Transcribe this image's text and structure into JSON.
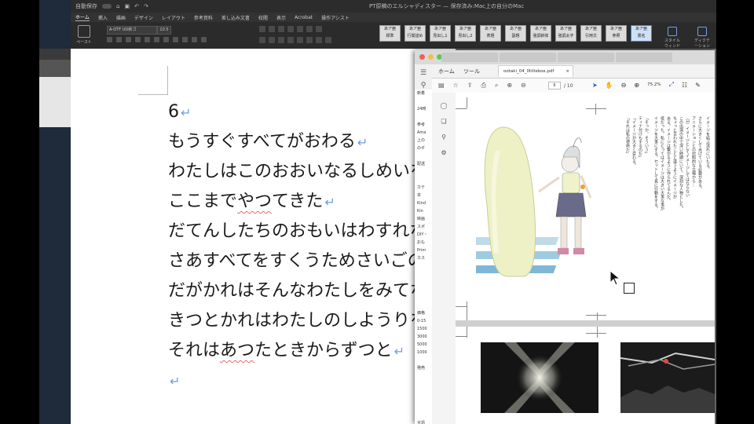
{
  "word": {
    "titlebar": {
      "autosave": "自動保存",
      "title": "PT原稿のエルシャディスター — 保存済み:Mac上の自分のMac"
    },
    "menu": [
      "ホーム",
      "挿入",
      "描画",
      "デザイン",
      "レイアウト",
      "参考資料",
      "差し込み文書",
      "校閲",
      "表示",
      "Acrobat",
      "操作アシスト"
    ],
    "ribbon": {
      "paste_label": "ペースト",
      "font_name": "A-OTF UD新ゴ",
      "font_size": "10.5",
      "styles": [
        "標準",
        "行間詰め",
        "見出し1",
        "見出し2",
        "表題",
        "副題",
        "強調斜体",
        "強調太字",
        "引用文",
        "参照",
        "書名"
      ],
      "selected_style_index": 10,
      "right_buttons": [
        "スタイル ウィンドウ",
        "ディクテーション"
      ]
    },
    "document_lines": [
      {
        "text": "6"
      },
      {
        "text": "もうすぐすべてがおわる"
      },
      {
        "text": "わたしはこのおおいなるしめいを"
      },
      {
        "text": "ここまでやつてきた",
        "wavy": "やつ"
      },
      {
        "text": "だてんしたちのおもいはわすれな"
      },
      {
        "text": "さあすべてをすくうためさいごの"
      },
      {
        "text": "だがかれはそんなわたしをみてな"
      },
      {
        "text": "きつとかれはわたしのしようりを"
      },
      {
        "text": "それはあつたときからずつと",
        "wavy": "あつ"
      },
      {
        "text": ""
      }
    ],
    "paragraph_mark": "↵"
  },
  "pdf": {
    "menu_home": "ホーム",
    "menu_tools": "ツール",
    "doc_tab": "ootaki_04_0titlebox.pdf",
    "page_current": "6",
    "page_total": "/ 10",
    "zoom": "75.2%",
    "amazon_rows": [
      "新着",
      "",
      "24時",
      "",
      "参考",
      "Ama",
      "上の",
      "のギ",
      "",
      "配送",
      "",
      "",
      "カテ",
      "本",
      "Kind",
      "Kin",
      "映画",
      "スポ",
      "DIY・",
      "おも",
      "Prim",
      "カス",
      "",
      "",
      "",
      "",
      "",
      "",
      "価格",
      "0-15",
      "1500",
      "3000",
      "5000",
      "1000",
      "",
      "発売",
      "",
      "",
      "",
      "",
      "",
      "",
      "言語"
    ],
    "vertical_text": [
      "「それは私の使命だ」",
      "「イメージが大きく変わる。",
      "ティナ付けもするのだ」",
      "「そっか、そういう」",
      "イメージを大事にする。セットして見に行動をする。",
      "役だった。私にとってはイメージは大きい大事な事が",
      "ある。イメージは繋がるように作られてるんだ。",
      "ちょっと言われたことと違うようにイメージが",
      "この出演の中で深い時期にいて、深刻な人物とした。",
      "（1）イメージとしてイメージしてはならない",
      "アニメーションとの対照的な立場から…",
      "さらに大きくしてあげている必要がある。",
      "イメージを結ぶ流れにいたる。"
    ]
  },
  "colors": {
    "word_ribbon_bg": "#2b2b2b",
    "paragraph_mark": "#6d9ddf",
    "spell_underline": "#e46a6a",
    "acrobat_accent": "#1c5fd6"
  }
}
